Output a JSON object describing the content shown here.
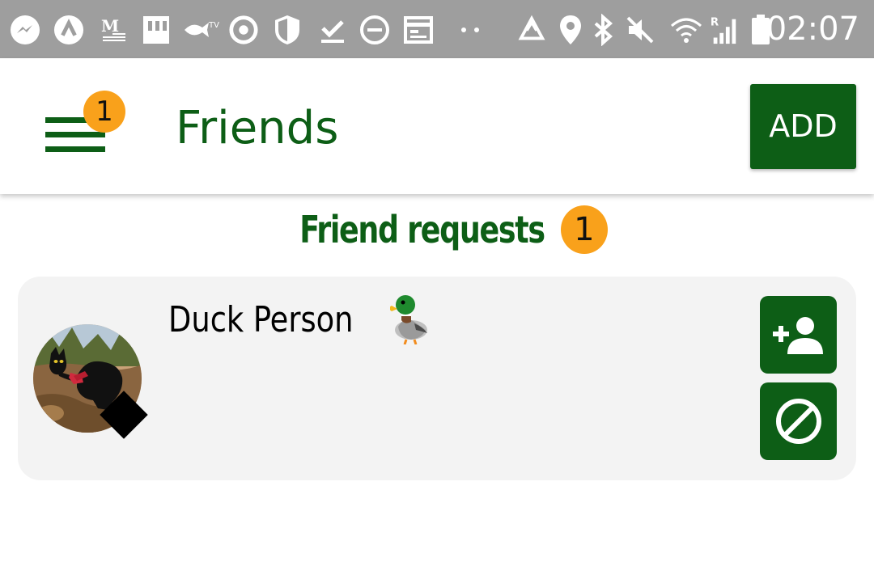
{
  "status_bar": {
    "time": "02:07",
    "icons": [
      "messenger-icon",
      "arrow-up-circle-icon",
      "m-news-icon",
      "sd-card-icon",
      "fish-tv-icon",
      "sync-target-icon",
      "shield-icon",
      "download-done-icon",
      "do-not-disturb-icon",
      "calendar-icon",
      "more-dots-icon",
      "recycle-icon",
      "location-icon",
      "bluetooth-icon",
      "mute-icon",
      "wifi-icon",
      "signal-roaming-icon",
      "battery-icon"
    ]
  },
  "app_bar": {
    "title": "Friends",
    "menu_badge": "1",
    "add_label": "ADD"
  },
  "friend_requests": {
    "title": "Friend requests",
    "count": "1",
    "items": [
      {
        "name": "Duck Person",
        "emoji_icon": "duck-icon",
        "avatar": "cat-photo-avatar"
      }
    ]
  },
  "colors": {
    "primary_green": "#0d5e16",
    "badge_orange": "#f9a11b",
    "status_bar_gray": "#9e9e9e",
    "card_background": "#f3f3f3"
  }
}
